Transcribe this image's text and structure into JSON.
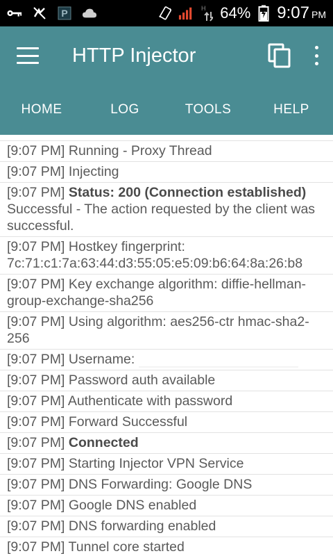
{
  "status_bar": {
    "battery": "64%",
    "time": "9:07",
    "ampm": "PM",
    "icons": [
      "key-icon",
      "no-sync-icon",
      "parking-icon",
      "cloud-icon",
      "phone-vibrate-icon",
      "signal-bars-icon",
      "hplus-data-icon",
      "battery-charging-icon"
    ]
  },
  "app_bar": {
    "title": "HTTP Injector",
    "icons": [
      "menu-icon",
      "copy-icon",
      "more-vert-icon"
    ]
  },
  "tabs": [
    {
      "label": "HOME"
    },
    {
      "label": "LOG"
    },
    {
      "label": "TOOLS"
    },
    {
      "label": "HELP"
    }
  ],
  "log": {
    "entries": [
      {
        "time": "[9:07 PM]",
        "text": "Running - Proxy Thread"
      },
      {
        "time": "[9:07 PM]",
        "text": "Injecting"
      },
      {
        "time": "[9:07 PM]",
        "bold": "Status: 200 (Connection established)",
        "text": "Successful - The action requested by the client was successful."
      },
      {
        "time": "[9:07 PM]",
        "text": "Hostkey fingerprint: 7c:71:c1:7a:63:44:d3:55:05:e5:09:b6:64:8a:26:b8"
      },
      {
        "time": "[9:07 PM]",
        "text": "Key exchange algorithm: diffie-hellman-group-exchange-sha256"
      },
      {
        "time": "[9:07 PM]",
        "text": "Using algorithm: aes256-ctr hmac-sha2-256"
      },
      {
        "time": "[9:07 PM]",
        "text": "Username:"
      },
      {
        "time": "[9:07 PM]",
        "text": "Password auth available"
      },
      {
        "time": "[9:07 PM]",
        "text": "Authenticate with password"
      },
      {
        "time": "[9:07 PM]",
        "text": "Forward Successful"
      },
      {
        "time": "[9:07 PM]",
        "bold": "Connected"
      },
      {
        "time": "[9:07 PM]",
        "text": "Starting Injector VPN Service"
      },
      {
        "time": "[9:07 PM]",
        "text": "DNS Forwarding: Google DNS"
      },
      {
        "time": "[9:07 PM]",
        "text": "Google DNS enabled"
      },
      {
        "time": "[9:07 PM]",
        "text": "DNS forwarding enabled"
      },
      {
        "time": "[9:07 PM]",
        "text": "Tunnel core started"
      }
    ]
  },
  "colors": {
    "appbar": "#4a8c93",
    "status_bar": "#000000",
    "signal": "#e2492f",
    "log_text": "#5a5a5a"
  }
}
